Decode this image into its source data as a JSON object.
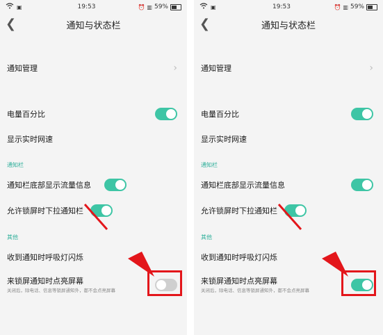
{
  "status": {
    "time": "19:53",
    "battery": "59%"
  },
  "header": {
    "title": "通知与状态栏"
  },
  "items": {
    "notification_manage": "通知管理",
    "battery_percent": "电量百分比",
    "network_speed": "显示实时网速",
    "section_notification": "通知栏",
    "traffic_info": "通知栏底部显示流量信息",
    "lockscreen_pulldown": "允许锁屏时下拉通知栏",
    "section_other": "其他",
    "breath_light": "收到通知时呼吸灯闪烁",
    "lock_screen_light": "来锁屏通知时点亮屏幕",
    "lock_screen_light_sub": "关闭后，除电话、信息等锁屏通知外，都不会点亮屏幕"
  },
  "toggles": {
    "left": {
      "battery_percent": true,
      "traffic_info": true,
      "lockscreen_pulldown": true,
      "lock_screen_light": false
    },
    "right": {
      "battery_percent": true,
      "traffic_info": true,
      "lockscreen_pulldown": true,
      "lock_screen_light": true
    }
  },
  "icons": {
    "back": "back-chevron-icon",
    "chevron": "chevron-right-icon",
    "wifi": "wifi-icon",
    "battery": "battery-icon",
    "alarm": "alarm-icon"
  },
  "colors": {
    "toggle_on": "#3ec5a5",
    "toggle_off": "#cfcfcf",
    "highlight": "#e3161b",
    "section": "#2eaf9a"
  }
}
